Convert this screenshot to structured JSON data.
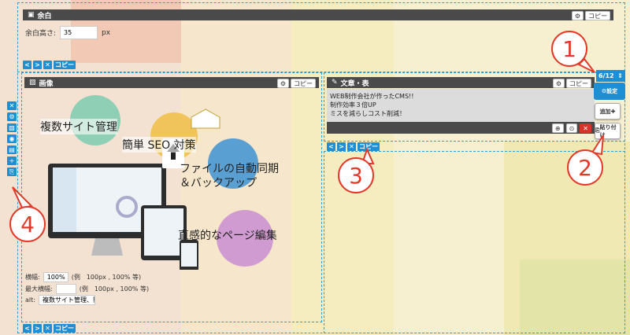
{
  "margin_block": {
    "title": "余白",
    "copy_label": "コピー",
    "height_label": "余白高さ:",
    "height_value": "35",
    "unit": "px"
  },
  "nav_copy": "コピー",
  "image_block": {
    "title": "画像",
    "copy_label": "コピー",
    "width_label": "横幅:",
    "width_value": "100%",
    "width_hint": "(例　100px , 100% 等)",
    "maxwidth_label": "最大横幅:",
    "maxwidth_value": "",
    "maxwidth_hint": "(例　100px , 100% 等)",
    "alt_label": "alt:",
    "alt_value": "複数サイト管理、簡単",
    "feature1": "複数サイト管理",
    "feature2": "簡単 SEO 対策",
    "feature3": "ファイルの自動同期\n＆バックアップ",
    "feature4": "直感的なページ編集"
  },
  "text_block": {
    "title": "文章・表",
    "copy_label": "コピー",
    "lines": [
      "WEB制作会社が作ったCMS!!",
      "制作効率３倍UP",
      "ミスを減らしコスト削減！"
    ],
    "badge": "6/12"
  },
  "popup": {
    "settings": "設定",
    "add": "追加",
    "paste": "貼り付け"
  },
  "callouts": [
    "1",
    "2",
    "3",
    "4"
  ],
  "colors": {
    "accent": "#1e8fd5",
    "callout": "#e53828",
    "bar": "#4a4a4a"
  }
}
